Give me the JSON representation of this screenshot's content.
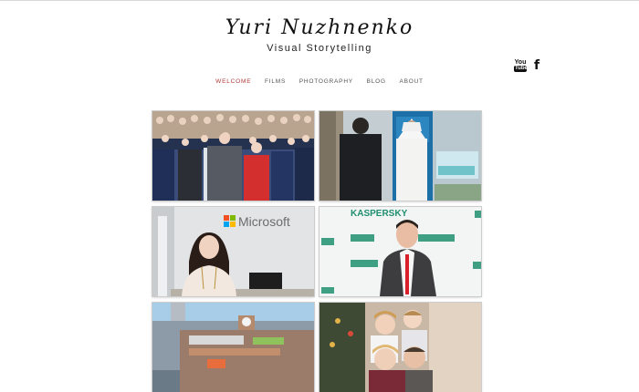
{
  "site": {
    "title": "Yuri Nuzhnenko",
    "tagline": "Visual Storytelling"
  },
  "social": {
    "youtube_label_top": "You",
    "youtube_label_bottom": "Tube",
    "facebook_label": "f"
  },
  "nav": {
    "items": [
      {
        "label": "WELCOME",
        "active": true
      },
      {
        "label": "FILMS",
        "active": false
      },
      {
        "label": "PHOTOGRAPHY",
        "active": false
      },
      {
        "label": "BLOG",
        "active": false
      },
      {
        "label": "ABOUT",
        "active": false
      }
    ]
  },
  "gallery": {
    "tiles": [
      {
        "icon": "crowd-photo"
      },
      {
        "icon": "meeting-photo"
      },
      {
        "icon": "microsoft-presenter-photo",
        "sign": "Microsoft"
      },
      {
        "icon": "kaspersky-photo",
        "sign": "KASPERSKY"
      },
      {
        "icon": "building-photo"
      },
      {
        "icon": "family-photo"
      }
    ]
  },
  "colors": {
    "accent": "#b23a3a",
    "nav_text": "#555555"
  }
}
